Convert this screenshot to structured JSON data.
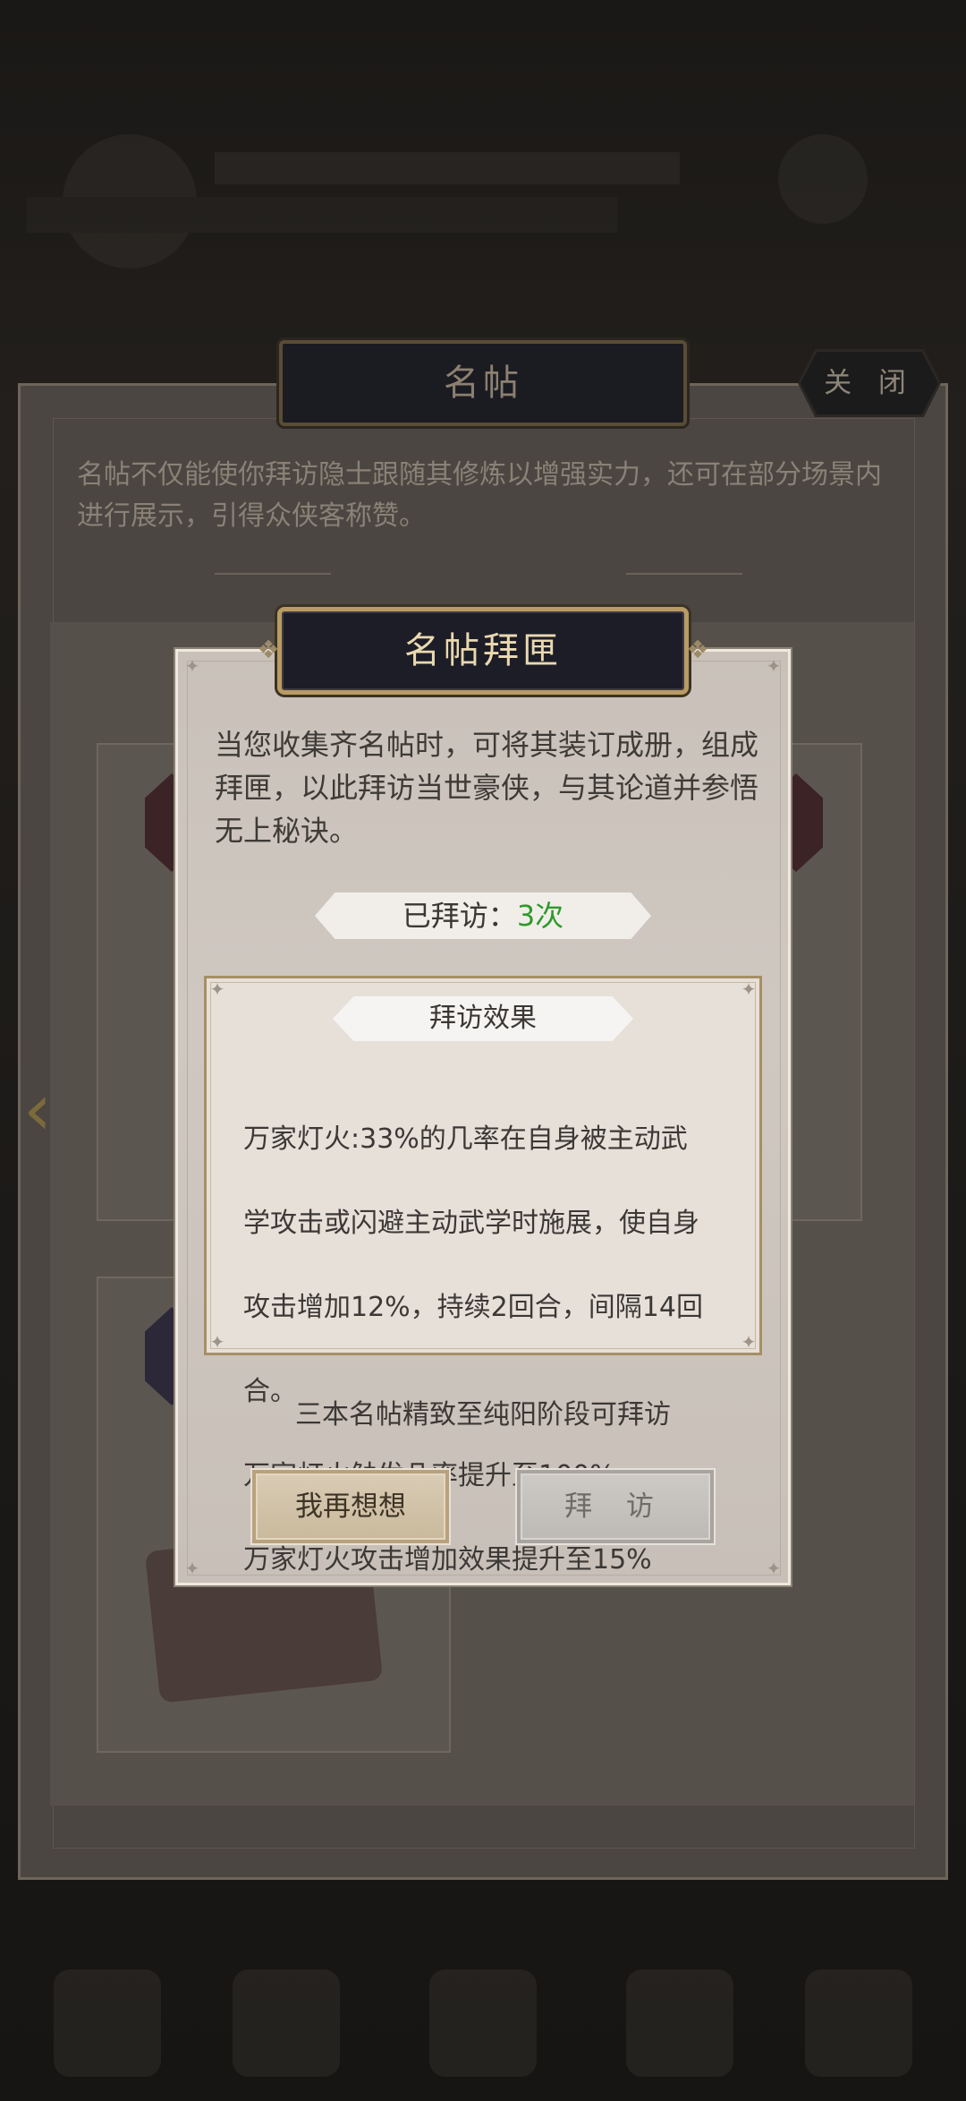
{
  "outer_panel": {
    "title": "名帖",
    "close_label": "关 闭",
    "description": "名帖不仅能使你拜访隐士跟随其修炼以增强实力，还可在部分场景内进行展示，引得众侠客称赞。"
  },
  "modal": {
    "title": "名帖拜匣",
    "description": "当您收集齐名帖时，可将其装订成册，组成拜匣，以此拜访当世豪侠，与其论道并参悟无上秘诀。",
    "visited_label": "已拜访：",
    "visited_count": "3次",
    "effect_title": "拜访效果",
    "effect_lines": [
      "万家灯火:33%的几率在自身被主动武",
      "学攻击或闪避主动武学时施展，使自身",
      "攻击增加12%，持续2回合，间隔14回",
      "合。",
      "万家灯火触发几率提升至100%",
      "万家灯火攻击增加效果提升至15%"
    ],
    "condition": "三本名帖精致至纯阳阶段可拜访",
    "buttons": {
      "think": "我再想想",
      "visit": "拜 访"
    }
  },
  "colors": {
    "visited_count": "#2f9a2a",
    "modal_title_text": "#ead8b0",
    "gold_border": "#b99b63"
  }
}
